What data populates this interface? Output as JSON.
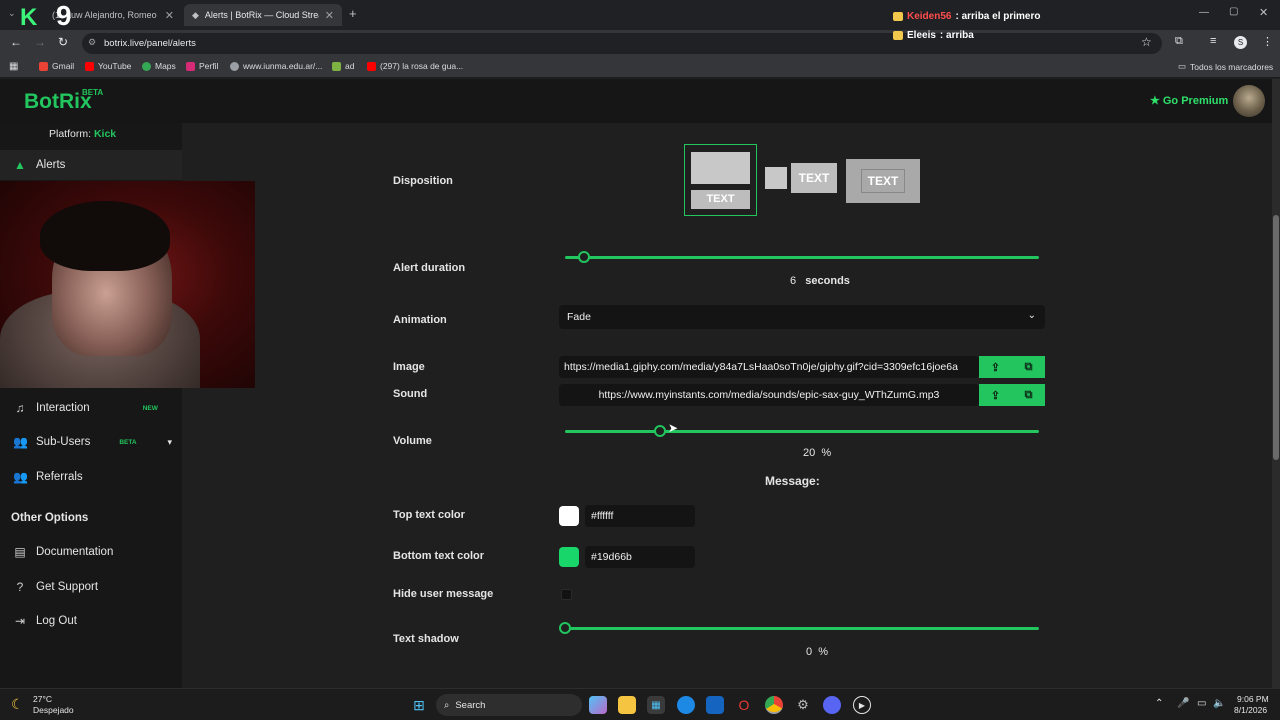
{
  "browser": {
    "tabs": [
      {
        "label": "auw Alejandro, Romeo",
        "prefix": "(1"
      },
      {
        "label": "Alerts | BotRix — Cloud Stream",
        "active": true
      }
    ],
    "new_tab_label": "+",
    "url": "botrix.live/panel/alerts",
    "bookmarks": [
      "Gmail",
      "YouTube",
      "Maps",
      "Perfil",
      "www.iunma.edu.ar/...",
      "ad",
      "(297) la rosa de gua..."
    ],
    "all_bookmarks": "Todos los marcadores"
  },
  "overlay": {
    "kick_logo": "K",
    "counter": "9",
    "chat": [
      {
        "user": "Keiden56",
        "message": ": arriba el primero",
        "user_color": "#ff4d4d"
      },
      {
        "user": "Eleeis",
        "message": ": arriba",
        "user_color": "#ffffff"
      }
    ]
  },
  "header": {
    "logo": "BotRix",
    "beta": "BETA",
    "premium": "Go Premium"
  },
  "sidebar": {
    "platform_label": "Platform:",
    "platform_value": "Kick",
    "items": [
      {
        "label": "Alerts",
        "icon": "warning-icon",
        "active": true
      },
      {
        "label": "Interaction",
        "icon": "music-icon",
        "badge": "NEW"
      },
      {
        "label": "Sub-Users",
        "icon": "users-icon",
        "badge": "BETA"
      },
      {
        "label": "Referrals",
        "icon": "referrals-icon"
      }
    ],
    "other_heading": "Other Options",
    "other_items": [
      {
        "label": "Documentation",
        "icon": "docs-icon"
      },
      {
        "label": "Get Support",
        "icon": "help-icon"
      },
      {
        "label": "Log Out",
        "icon": "logout-icon"
      }
    ]
  },
  "form": {
    "disposition_label": "Disposition",
    "disposition_options": [
      "TEXT",
      "TEXT",
      "TEXT"
    ],
    "alert_duration_label": "Alert duration",
    "alert_duration_value": "6",
    "alert_duration_unit": "seconds",
    "alert_duration_fraction": 0.04,
    "animation_label": "Animation",
    "animation_value": "Fade",
    "image_label": "Image",
    "image_url": "https://media1.giphy.com/media/y84a7LsHaa0soTn0je/giphy.gif?cid=3309efc16joe6a",
    "sound_label": "Sound",
    "sound_url": "https://www.myinstants.com/media/sounds/epic-sax-guy_WThZumG.mp3",
    "volume_label": "Volume",
    "volume_value": "20",
    "volume_unit": "%",
    "volume_fraction": 0.2,
    "message_heading": "Message:",
    "top_color_label": "Top text color",
    "top_color_value": "#ffffff",
    "bottom_color_label": "Bottom text color",
    "bottom_color_value": "#19d66b",
    "hide_message_label": "Hide user message",
    "text_shadow_label": "Text shadow",
    "text_shadow_value": "0",
    "text_shadow_unit": "%",
    "text_shadow_fraction": 0.0
  },
  "taskbar": {
    "weather_temp": "27°C",
    "weather_desc": "Despejado",
    "search_label": "Search",
    "time": "9:06 PM",
    "date": "8/1/2026"
  },
  "colors": {
    "accent": "#22c55e",
    "page_bg": "#1f1f1f",
    "sidebar_bg": "#171717"
  }
}
